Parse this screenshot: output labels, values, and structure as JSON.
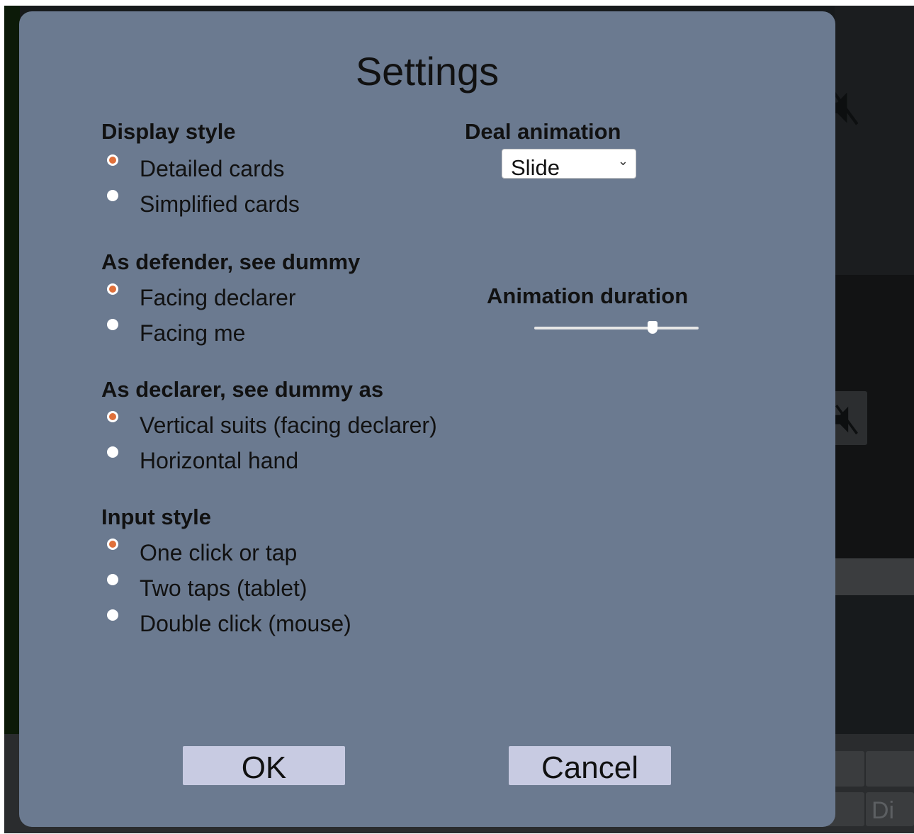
{
  "dialog": {
    "title": "Settings"
  },
  "display_style": {
    "label": "Display style",
    "options": [
      {
        "label": "Detailed cards",
        "checked": true
      },
      {
        "label": "Simplified cards",
        "checked": false
      }
    ]
  },
  "defender_view": {
    "label": "As defender, see dummy",
    "options": [
      {
        "label": "Facing declarer",
        "checked": true
      },
      {
        "label": "Facing me",
        "checked": false
      }
    ]
  },
  "declarer_view": {
    "label": "As declarer, see dummy as",
    "options": [
      {
        "label": "Vertical suits (facing declarer)",
        "checked": true
      },
      {
        "label": "Horizontal hand",
        "checked": false
      }
    ]
  },
  "input_style": {
    "label": "Input style",
    "options": [
      {
        "label": "One click or tap",
        "checked": true
      },
      {
        "label": "Two taps (tablet)",
        "checked": false
      },
      {
        "label": "Double click (mouse)",
        "checked": false
      }
    ]
  },
  "deal_animation": {
    "label": "Deal animation",
    "selected": "Slide"
  },
  "animation_duration": {
    "label": "Animation duration",
    "value_fraction": 0.72
  },
  "buttons": {
    "ok": "OK",
    "cancel": "Cancel"
  },
  "background": {
    "bottom_button_partial": "Di"
  },
  "colors": {
    "modal_bg": "#6b7a90",
    "radio_checked": "#e0703a",
    "button_bg": "#c8cbe2"
  }
}
